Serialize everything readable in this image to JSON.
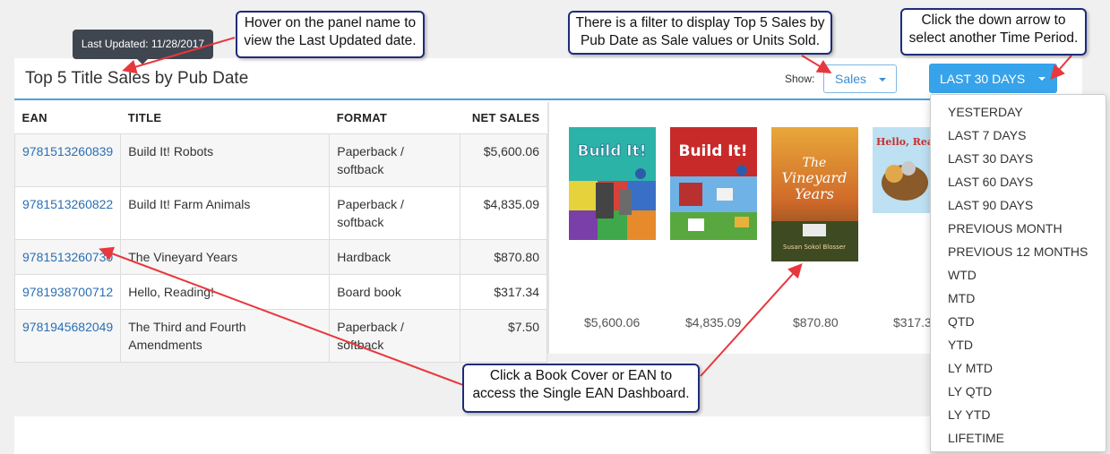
{
  "panel": {
    "title": "Top 5 Title Sales by Pub Date",
    "show_label": "Show:",
    "measure_select": "Sales",
    "period_button": "LAST 30 DAYS"
  },
  "tooltip": {
    "text": "Last Updated: 11/28/2017"
  },
  "table": {
    "headers": [
      "EAN",
      "TITLE",
      "FORMAT",
      "NET SALES"
    ],
    "rows": [
      {
        "ean": "9781513260839",
        "title": "Build It! Robots",
        "format": "Paperback / softback",
        "net_sales": "$5,600.06"
      },
      {
        "ean": "9781513260822",
        "title": "Build It! Farm Animals",
        "format": "Paperback / softback",
        "net_sales": "$4,835.09"
      },
      {
        "ean": "9781513260730",
        "title": "The Vineyard Years",
        "format": "Hardback",
        "net_sales": "$870.80"
      },
      {
        "ean": "9781938700712",
        "title": "Hello, Reading!",
        "format": "Board book",
        "net_sales": "$317.34"
      },
      {
        "ean": "9781945682049",
        "title": "The Third and Fourth Amendments",
        "format": "Paperback / softback",
        "net_sales": "$7.50"
      }
    ]
  },
  "covers": [
    {
      "cover_text": "Build It!",
      "price": "$5,600.06"
    },
    {
      "cover_text": "Build It!",
      "price": "$4,835.09"
    },
    {
      "cover_text_line1": "The",
      "cover_text_line2": "Vineyard",
      "cover_text_line3": "Years",
      "author": "Susan Sokol Blosser",
      "price": "$870.80"
    },
    {
      "cover_text": "Hello, Rea",
      "price": "$317.3"
    }
  ],
  "dropdown": {
    "options": [
      "YESTERDAY",
      "LAST 7 DAYS",
      "LAST 30 DAYS",
      "LAST 60 DAYS",
      "LAST 90 DAYS",
      "PREVIOUS MONTH",
      "PREVIOUS 12 MONTHS",
      "WTD",
      "MTD",
      "QTD",
      "YTD",
      "LY MTD",
      "LY QTD",
      "LY YTD",
      "LIFETIME"
    ]
  },
  "callouts": {
    "hover": "Hover on the panel name to view the Last Updated date.",
    "filter": "There is a filter to display Top 5 Sales by Pub Date as Sale values or Units Sold.",
    "period": "Click the down arrow to select another Time Period.",
    "cover": "Click a Book Cover or EAN to access the Single EAN Dashboard."
  },
  "colors": {
    "accent": "#36a3ea",
    "link": "#2a6fb3",
    "callout_border": "#1f2c7a",
    "annotation_arrow": "#e8383d"
  }
}
